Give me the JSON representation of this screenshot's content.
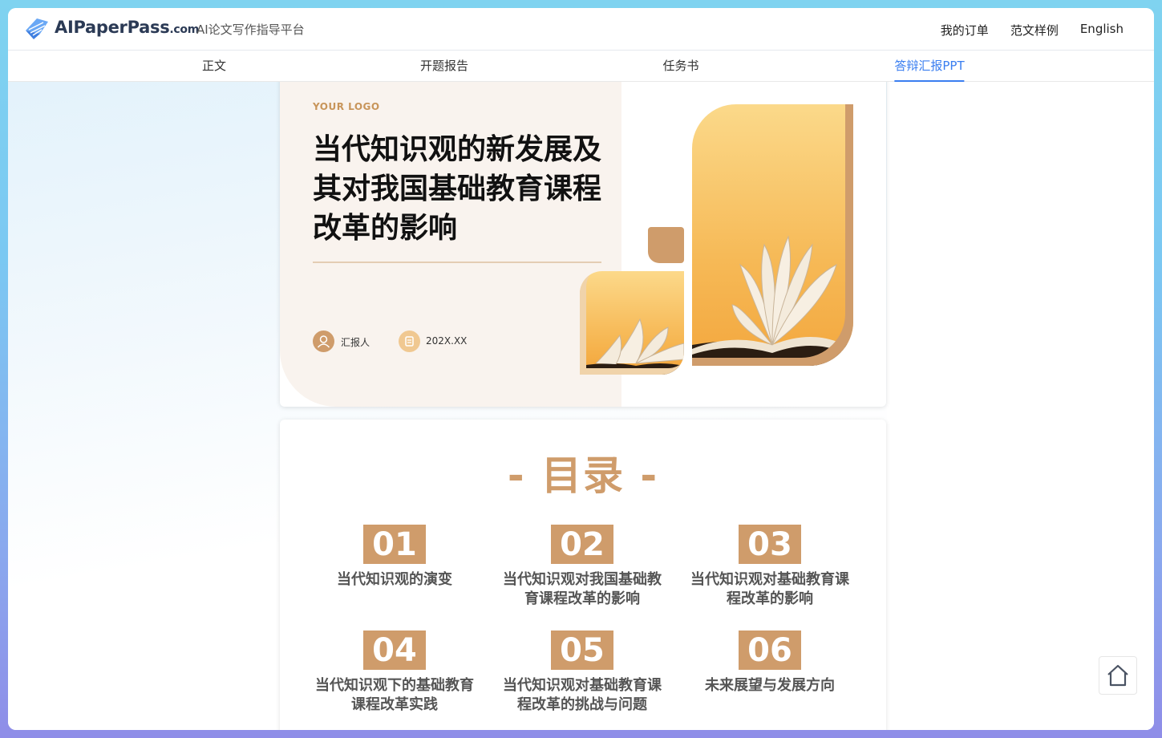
{
  "brand": {
    "name": "AIPaperPass",
    "domain_suffix": ".com",
    "slogan": "AI论文写作指导平台"
  },
  "topnav": {
    "orders": "我的订单",
    "samples": "范文样例",
    "language": "English"
  },
  "tabs": [
    {
      "label": "正文",
      "active": false
    },
    {
      "label": "开题报告",
      "active": false
    },
    {
      "label": "任务书",
      "active": false
    },
    {
      "label": "答辩汇报PPT",
      "active": true
    }
  ],
  "slide1": {
    "logo_text": "YOUR LOGO",
    "title": "当代知识观的新发展及其对我国基础教育课程改革的影响",
    "reporter_label": "汇报人",
    "date": "202X.XX"
  },
  "slide2": {
    "title": "- 目录 -",
    "items": [
      {
        "num": "01",
        "text": "当代知识观的演变"
      },
      {
        "num": "02",
        "text": "当代知识观对我国基础教育课程改革的影响"
      },
      {
        "num": "03",
        "text": "当代知识观对基础教育课程改革的影响"
      },
      {
        "num": "04",
        "text": "当代知识观下的基础教育课程改革实践"
      },
      {
        "num": "05",
        "text": "当代知识观对基础教育课程改革的挑战与问题"
      },
      {
        "num": "06",
        "text": "未来展望与发展方向"
      }
    ]
  },
  "colors": {
    "accent": "#cf9c6b",
    "tab_active": "#3a7ef0",
    "slide_panel": "#f9f3ee"
  },
  "icons": {
    "logo": "feather-logo-icon",
    "reporter": "user-icon",
    "date": "calendar-icon",
    "home": "home-icon"
  }
}
